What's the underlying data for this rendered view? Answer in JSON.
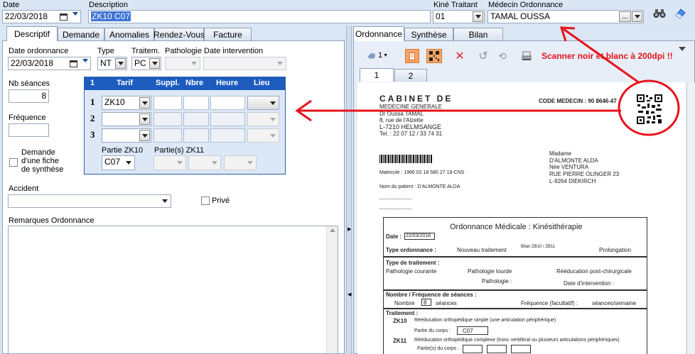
{
  "header": {
    "date_label": "Date",
    "date_value": "22/03/2018",
    "description_label": "Description",
    "description_value": "ZK10 C07",
    "kine_label": "Kiné Traitant",
    "kine_value": "01",
    "medecin_label": "Médecin Ordonnance",
    "medecin_value": "TAMAL OUSSA",
    "ellipsis_label": "..."
  },
  "left_tabs": [
    {
      "label": "Descriptif"
    },
    {
      "label": "Demande"
    },
    {
      "label": "Anomalies"
    },
    {
      "label": "Rendez-Vous"
    },
    {
      "label": "Facture"
    }
  ],
  "form": {
    "date_ordonnance_label": "Date ordonnance",
    "date_ordonnance_value": "22/03/2018",
    "type_label": "Type",
    "type_value": "NT",
    "traitem_label": "Traitem.",
    "traitem_value": "PC",
    "pathologie_label": "Pathologie",
    "date_intervention_label": "Date intervention",
    "nb_seances_label": "Nb séances",
    "nb_seances_value": "8",
    "frequence_label": "Fréquence",
    "demande_label_1": "Demande",
    "demande_label_2": "d'une fiche",
    "demande_label_3": "de synthèse",
    "accident_label": "Accident",
    "prive_label": "Privé",
    "remarques_label": "Remarques Ordonnance"
  },
  "grid": {
    "headers": [
      "1",
      "Tarif",
      "Suppl.",
      "Nbre",
      "Heure",
      "Lieu"
    ],
    "row_numbers": [
      "1",
      "2",
      "3"
    ],
    "row1_tarif": "ZK10",
    "partie_zk10_label": "Partie ZK10",
    "partie_zk10_value": "C07",
    "parties_zk11_label": "Partie(s) ZK11"
  },
  "right_tabs": [
    {
      "label": "Ordonnance"
    },
    {
      "label": "Synthèse"
    },
    {
      "label": "Bilan"
    }
  ],
  "viewer": {
    "page_count_label": "1",
    "page1_tab": "1",
    "page2_tab": "2",
    "warning": "Scanner noir et blanc à 200dpi !!"
  },
  "document": {
    "cabinet_title": "CABINET DE",
    "cabinet_sub": "MEDECINE GENERALE",
    "doctor": "Dr Oussa TAMAL",
    "street": "8, rue de l'Alzette",
    "city": "L-7210 HELMSANGE",
    "tel": "Tel. : 22 07 12 / 33 74 31",
    "code_medecin": "CODE MEDECIN : 90 8646-47",
    "patient_title": "Madame",
    "patient_name": "D'ALMONTE ALDA",
    "patient_nee": "Née VENTURA",
    "patient_street": "RUE PIERRE OLINGER 23",
    "patient_city": "L-9264 DIEKIRCH",
    "matricule": "Matricule : 1966 02 18 580 27   18-CNS",
    "patient_line": "Nom du patient : D'ALMONTE ALDA",
    "ordonnance_title": "Ordonnance Médicale : Kinésithérapie",
    "date_label": "Date :",
    "date_value": "22/03/2018",
    "type_ord_label": "Type ordonnance :",
    "nouveau": "Nouveau traitement",
    "bilan": "Bilan ZB10 / ZB11",
    "prolongation": "Prolongation",
    "type_traitement": "Type de traitement :",
    "pathologie_courante": "Pathologie courante",
    "pathologie_lourde": "Pathologie lourde",
    "reeducation": "Rééducation post-chirurgicale",
    "pathologie_field": "Pathologie :",
    "date_intervention": "Date d'intervention :",
    "frequence_title": "Nombre / Fréquence de séances :",
    "nombre": "Nombre",
    "nombre_value": "8",
    "seances": "séances",
    "frequence": "Fréquence (facultatif) :",
    "seances_semaine": "séances/semaine",
    "traitement_title": "Traitement :",
    "zk10": "ZK10",
    "zk10_text": "Rééducation orthopédique simple (une articulation périphérique)",
    "partie_corps": "Partie du corps :",
    "partie_value": "C07",
    "zk11": "ZK11",
    "zk11_text": "Rééducation orthopédique complexe (tronc vertébral ou plusieurs articulations périphériques)",
    "parties_corps": "Partie(s) du corps :"
  }
}
